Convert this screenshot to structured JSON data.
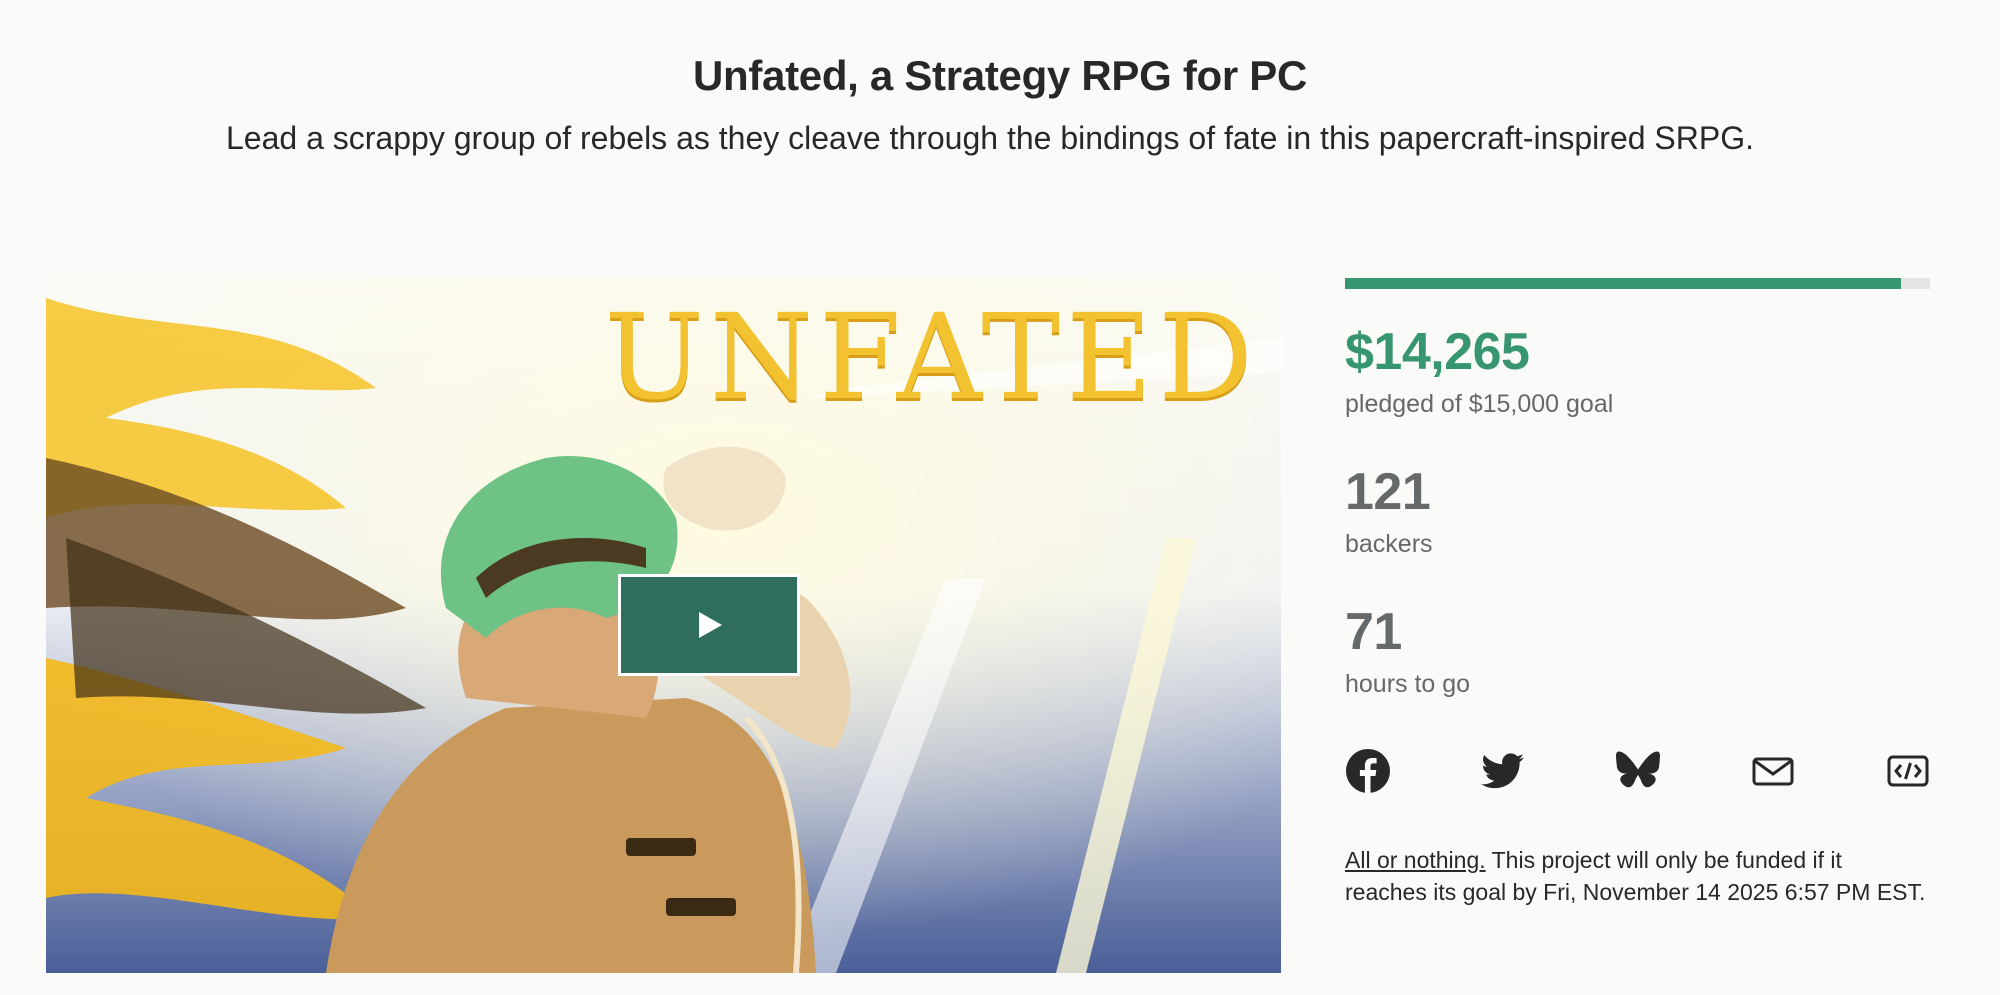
{
  "project": {
    "title": "Unfated, a Strategy RPG for PC",
    "blurb": "Lead a scrappy group of rebels as they cleave through the bindings of fate in this papercraft-inspired SRPG."
  },
  "media": {
    "logo_text": "UNFATED",
    "play_icon": "play-icon"
  },
  "funding": {
    "pledged": "$14,265",
    "pledged_label": "pledged of $15,000 goal",
    "progress_fraction": 0.951,
    "backers": "121",
    "backers_label": "backers",
    "time_left": "71",
    "time_left_label": "hours to go"
  },
  "share": {
    "icons": [
      "facebook-icon",
      "twitter-icon",
      "bluesky-icon",
      "email-icon",
      "embed-icon"
    ]
  },
  "funding_note": {
    "link_text": "All or nothing.",
    "text": " This project will only be funded if it reaches its goal by Fri, November 14 2025 6:57 PM EST."
  },
  "colors": {
    "accent_green": "#37966f",
    "play_button": "#2f6e5d",
    "muted_text": "#656969"
  }
}
